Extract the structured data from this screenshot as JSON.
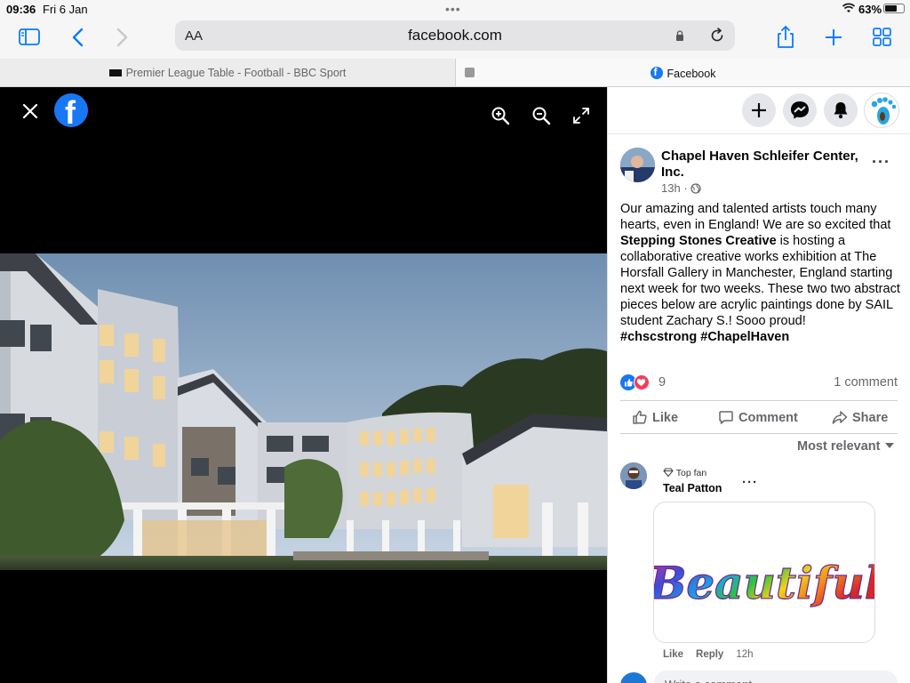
{
  "status": {
    "time": "09:36",
    "date": "Fri 6 Jan",
    "battery": "63%"
  },
  "browser": {
    "aa_label": "AA",
    "url": "facebook.com",
    "tabs": [
      {
        "label": "Premier League Table - Football - BBC Sport",
        "active": false
      },
      {
        "label": "Facebook",
        "active": true
      }
    ]
  },
  "post": {
    "page_name": "Chapel Haven Schleifer Center, Inc.",
    "time_ago": "13h",
    "text_before": "Our amazing and talented artists touch many hearts, even in England! We are so excited that ",
    "text_bold": "Stepping Stones Creative",
    "text_after": " is hosting a collaborative creative works exhibition at The Horsfall Gallery in Manchester, England starting next week for two weeks. These two two abstract pieces below are acrylic paintings done by SAIL student Zachary S.! Sooo proud!",
    "hashtags": "#chscstrong #ChapelHaven",
    "reaction_count": "9",
    "comment_count": "1 comment",
    "actions": {
      "like": "Like",
      "comment": "Comment",
      "share": "Share"
    },
    "sort_label": "Most relevant"
  },
  "comment": {
    "badge": "Top fan",
    "name": "Teal Patton",
    "image_text": "Beautiful",
    "like": "Like",
    "reply": "Reply",
    "time": "12h"
  },
  "write_placeholder": "Write a comment...",
  "colors": {
    "accent": "#0a7aff",
    "facebook_blue": "#1877f2",
    "love_red": "#f33e58"
  }
}
